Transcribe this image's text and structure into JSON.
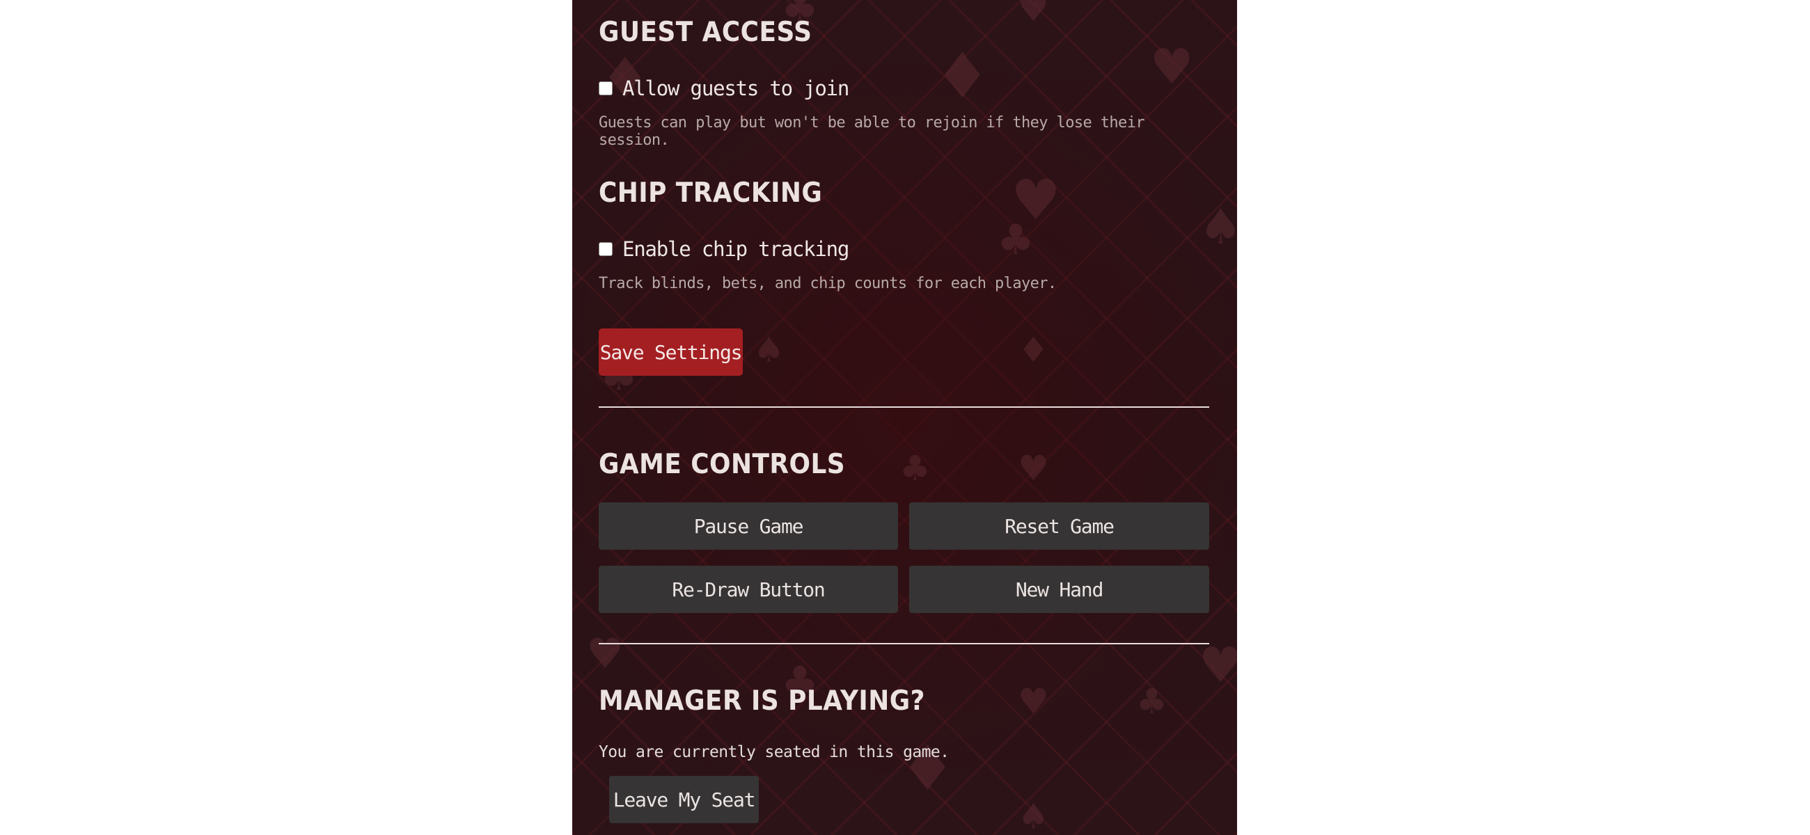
{
  "guest_access": {
    "heading": "GUEST ACCESS",
    "checkbox_label": "Allow guests to join",
    "checked": false,
    "hint": "Guests can play but won't be able to rejoin if they lose their session."
  },
  "chip_tracking": {
    "heading": "CHIP TRACKING",
    "checkbox_label": "Enable chip tracking",
    "checked": false,
    "hint": "Track blinds, bets, and chip counts for each player."
  },
  "save_button": "Save Settings",
  "game_controls": {
    "heading": "GAME CONTROLS",
    "buttons": [
      "Pause Game",
      "Reset Game",
      "Re-Draw Button",
      "New Hand"
    ]
  },
  "manager_playing": {
    "heading": "MANAGER IS PLAYING?",
    "status": "You are currently seated in this game.",
    "leave_button": "Leave My Seat"
  },
  "colors": {
    "panel_background": "#2a1216",
    "primary_button": "#a41f22",
    "secondary_button": "#363434",
    "heading_text": "#ece3e1",
    "hint_text": "#b8a9a7"
  },
  "icons": [
    "heart-icon",
    "diamond-icon",
    "club-icon",
    "spade-icon"
  ]
}
